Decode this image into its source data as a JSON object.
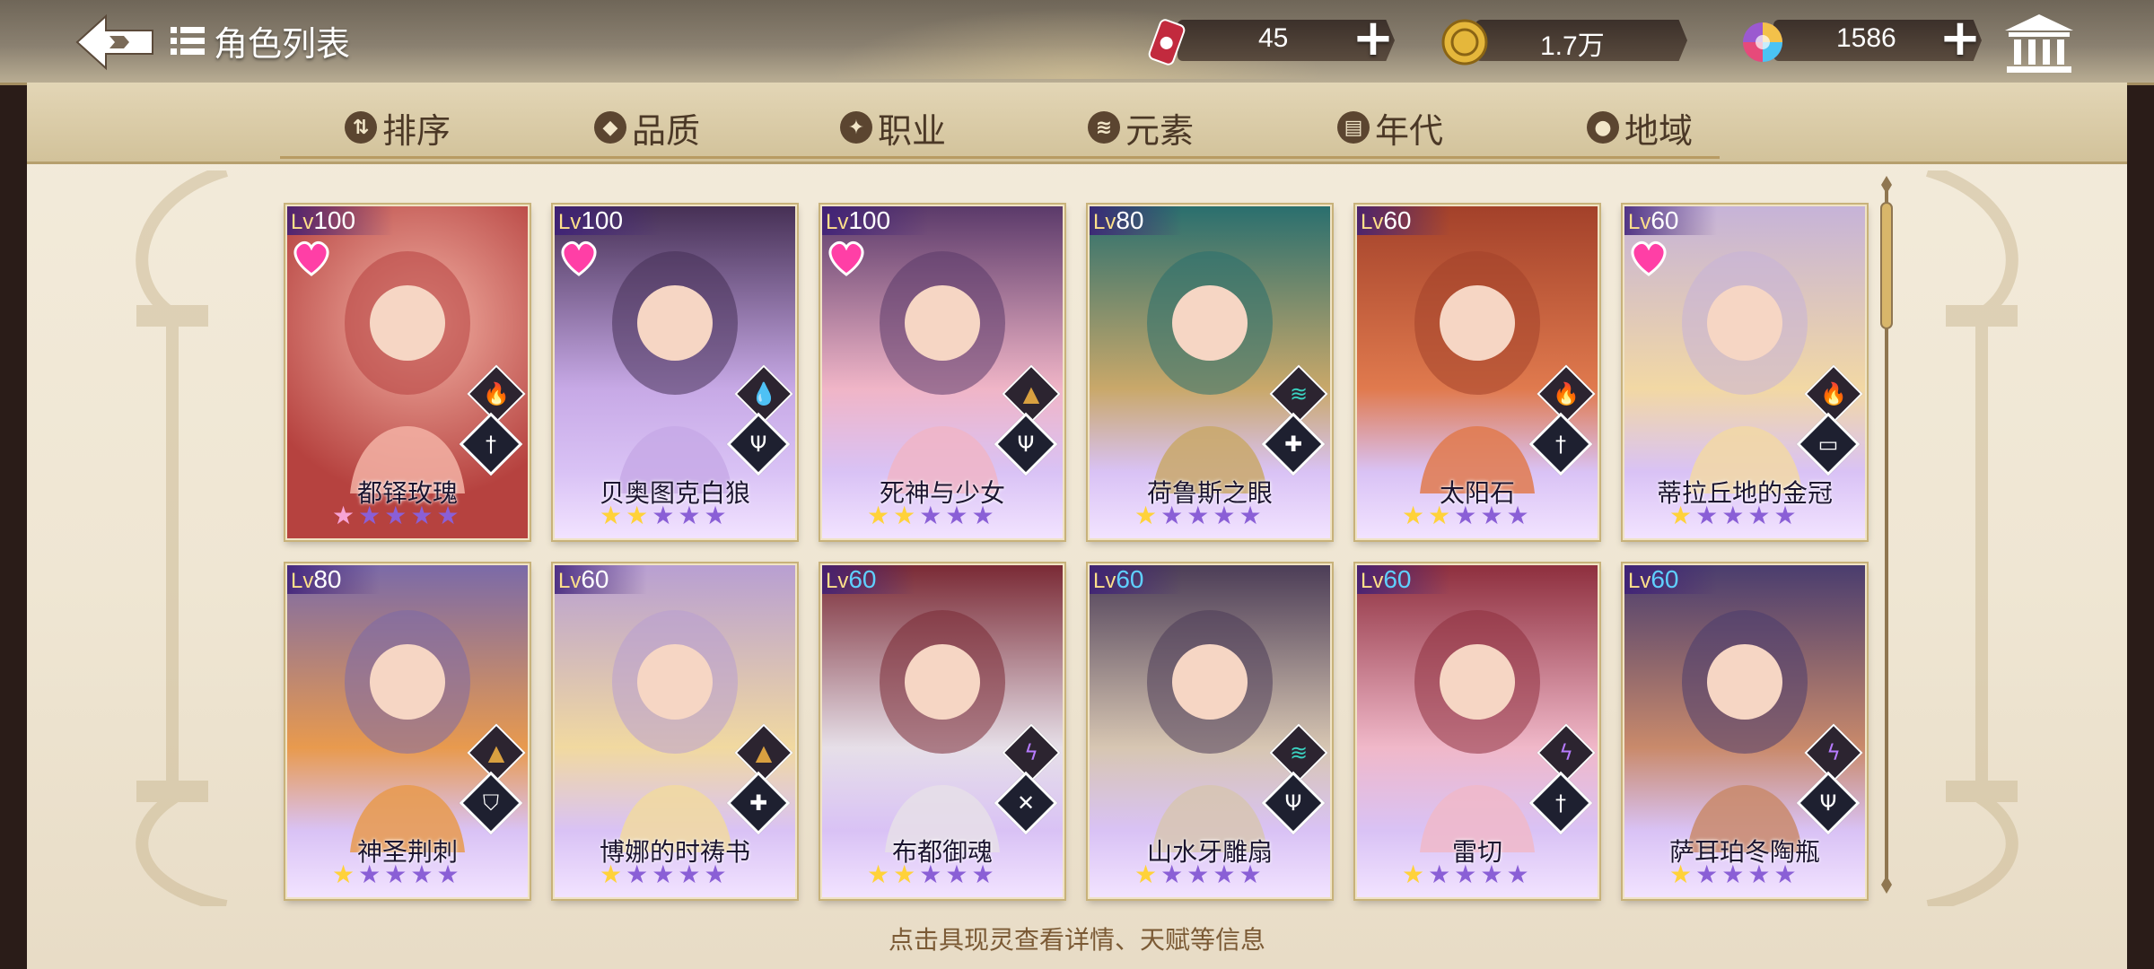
{
  "header": {
    "title": "角色列表",
    "resources": [
      {
        "name": "stamina",
        "icon": "red-can-icon",
        "value": "45"
      },
      {
        "name": "gold",
        "icon": "gold-coin-icon",
        "value": "1.7万"
      },
      {
        "name": "gem",
        "icon": "rainbow-gem-icon",
        "value": "1586"
      }
    ]
  },
  "tabs": [
    {
      "label": "排序",
      "icon": "sort-icon"
    },
    {
      "label": "品质",
      "icon": "quality-icon"
    },
    {
      "label": "职业",
      "icon": "class-icon"
    },
    {
      "label": "元素",
      "icon": "element-icon"
    },
    {
      "label": "年代",
      "icon": "era-icon"
    },
    {
      "label": "地域",
      "icon": "region-icon"
    }
  ],
  "cards": [
    {
      "level": "100",
      "name": "都铎玫瑰",
      "favorite": true,
      "element": "fire",
      "class": "sword",
      "stars": 1,
      "special": true,
      "bg": "#b6423f",
      "bg2": "#f3b2a5",
      "star_color": "pink",
      "lv_color": "#ffffff"
    },
    {
      "level": "100",
      "name": "贝奥图克白狼",
      "favorite": true,
      "element": "water",
      "class": "trident",
      "stars": 2,
      "special": false,
      "bg": "#463055",
      "bg2": "#c7a9e6",
      "star_color": "gold",
      "lv_color": "#ffffff"
    },
    {
      "level": "100",
      "name": "死神与少女",
      "favorite": true,
      "element": "earth",
      "class": "trident",
      "stars": 2,
      "special": false,
      "bg": "#5b3a6a",
      "bg2": "#f0b5c7",
      "star_color": "gold",
      "lv_color": "#ffffff"
    },
    {
      "level": "80",
      "name": "荷鲁斯之眼",
      "favorite": false,
      "element": "wind",
      "class": "cross",
      "stars": 1,
      "special": false,
      "bg": "#2a6f6e",
      "bg2": "#c9a86a",
      "star_color": "gold",
      "lv_color": "#ffffff"
    },
    {
      "level": "60",
      "name": "太阳石",
      "favorite": false,
      "element": "fire",
      "class": "sword",
      "stars": 2,
      "special": false,
      "bg": "#a3412a",
      "bg2": "#e07a4e",
      "star_color": "gold",
      "lv_color": "#ffffff"
    },
    {
      "level": "60",
      "name": "蒂拉丘地的金冠",
      "favorite": true,
      "element": "fire",
      "class": "book",
      "stars": 1,
      "special": false,
      "bg": "#c6b3d8",
      "bg2": "#f2d8a4",
      "star_color": "gold",
      "lv_color": "#ffffff"
    },
    {
      "level": "80",
      "name": "神圣荆刺",
      "favorite": false,
      "element": "earth",
      "class": "shield",
      "stars": 1,
      "special": false,
      "bg": "#7b6aa8",
      "bg2": "#e89a4e",
      "star_color": "gold",
      "lv_color": "#ffffff"
    },
    {
      "level": "60",
      "name": "博娜的时祷书",
      "favorite": false,
      "element": "earth",
      "class": "cross",
      "stars": 1,
      "special": false,
      "bg": "#b89fd2",
      "bg2": "#f1d9a0",
      "star_color": "gold",
      "lv_color": "#ffffff"
    },
    {
      "level": "60",
      "name": "布都御魂",
      "favorite": false,
      "element": "thunder",
      "class": "crossed-swords",
      "stars": 2,
      "special": false,
      "bg": "#7a2a35",
      "bg2": "#e6dfe8",
      "star_color": "gold",
      "lv_color": "#5fd0ff"
    },
    {
      "level": "60",
      "name": "山水牙雕扇",
      "favorite": false,
      "element": "wind",
      "class": "trident",
      "stars": 1,
      "special": false,
      "bg": "#4c3d57",
      "bg2": "#d7c6b2",
      "star_color": "gold",
      "lv_color": "#5fd0ff"
    },
    {
      "level": "60",
      "name": "雷切",
      "favorite": false,
      "element": "thunder",
      "class": "sword",
      "stars": 1,
      "special": false,
      "bg": "#8e2f3e",
      "bg2": "#f0b8c9",
      "star_color": "gold",
      "lv_color": "#5fd0ff"
    },
    {
      "level": "60",
      "name": "萨耳珀冬陶瓶",
      "favorite": false,
      "element": "thunder",
      "class": "trident",
      "stars": 1,
      "special": false,
      "bg": "#4a3d6e",
      "bg2": "#c98a6b",
      "star_color": "gold",
      "lv_color": "#5fd0ff"
    }
  ],
  "hint": "点击具现灵查看详情、天赋等信息",
  "colors": {
    "accent_gold": "#c8a24a",
    "tab_text": "#4b3826",
    "hint_text": "#7b5a35"
  }
}
